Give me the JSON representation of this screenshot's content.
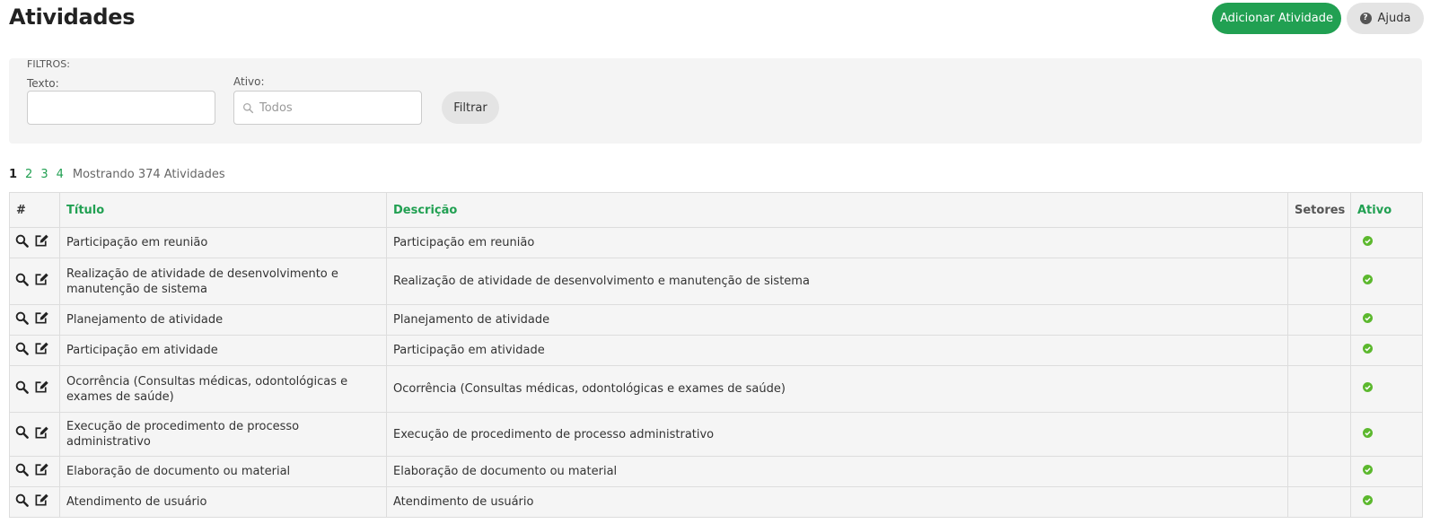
{
  "header": {
    "title": "Atividades",
    "add_label": "Adicionar Atividade",
    "help_label": "Ajuda"
  },
  "filters": {
    "title": "FILTROS:",
    "texto_label": "Texto:",
    "texto_value": "",
    "ativo_label": "Ativo:",
    "ativo_placeholder": "Todos",
    "filter_button": "Filtrar"
  },
  "pagination": {
    "pages": [
      "1",
      "2",
      "3",
      "4"
    ],
    "current": "1",
    "summary": "Mostrando 374 Atividades"
  },
  "table": {
    "columns": {
      "hash": "#",
      "titulo": "Título",
      "descricao": "Descrição",
      "setores": "Setores",
      "ativo": "Ativo"
    },
    "rows": [
      {
        "titulo": "Participação em reunião",
        "descricao": "Participação em reunião",
        "setores": "",
        "ativo": true
      },
      {
        "titulo": "Realização de atividade de desenvolvimento e manutenção de sistema",
        "descricao": "Realização de atividade de desenvolvimento e manutenção de sistema",
        "setores": "",
        "ativo": true
      },
      {
        "titulo": "Planejamento de atividade",
        "descricao": "Planejamento de atividade",
        "setores": "",
        "ativo": true
      },
      {
        "titulo": "Participação em atividade",
        "descricao": "Participação em atividade",
        "setores": "",
        "ativo": true
      },
      {
        "titulo": "Ocorrência (Consultas médicas, odontológicas e exames de saúde)",
        "descricao": "Ocorrência (Consultas médicas, odontológicas e exames de saúde)",
        "setores": "",
        "ativo": true
      },
      {
        "titulo": "Execução de procedimento de processo administrativo",
        "descricao": "Execução de procedimento de processo administrativo",
        "setores": "",
        "ativo": true
      },
      {
        "titulo": "Elaboração de documento ou material",
        "descricao": "Elaboração de documento ou material",
        "setores": "",
        "ativo": true
      },
      {
        "titulo": "Atendimento de usuário",
        "descricao": "Atendimento de usuário",
        "setores": "",
        "ativo": true
      }
    ]
  },
  "colors": {
    "accent": "#21a052",
    "active_check": "#5cb82e"
  },
  "icons": {
    "view": "search-icon",
    "edit": "edit-icon",
    "help": "question-circle-icon",
    "active": "check-circle-icon"
  }
}
